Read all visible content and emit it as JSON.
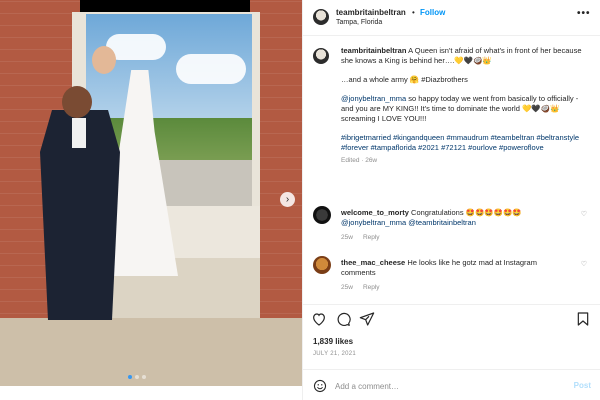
{
  "header": {
    "username": "teambritainbeltran",
    "separator": "•",
    "follow_label": "Follow",
    "location": "Tampa, Florida",
    "more_label": "•••"
  },
  "carousel": {
    "next_label": "›",
    "slides": 3,
    "active_slide": 1
  },
  "caption": {
    "username": "teambritainbeltran",
    "line1": "A Queen isn't afraid of what's in front of her because she knows a King is behind her….💛🖤🥥👑",
    "line2": "…and a whole army 🤗 #Diazbrothers",
    "mention": "@jonybeltran_mma",
    "line3": "so happy today we went from basically to officially - and you are MY KING!! It's time to dominate the world 💛🖤🥥👑 screaming I LOVE YOU!!!",
    "hashtags": "#ibrigetmarried #kingandqueen #mmaudrum #teambeltran #beltranstyle #forever #tampaflorida #2021 #72121 #ourlove #poweroflove",
    "time": "Edited · 26w"
  },
  "comments": [
    {
      "username": "welcome_to_morty",
      "text": "Congratulations 🤩🤩🤩🤩🤩🤩",
      "mention": "@jonybeltran_mma @teambritainbeltran",
      "time": "25w",
      "reply_label": "Reply"
    },
    {
      "username": "thee_mac_cheese",
      "text": "He looks like he gotz mad at Instagram comments",
      "time": "25w",
      "reply_label": "Reply"
    }
  ],
  "actions": {
    "likes": "1,839 likes",
    "date": "JULY 21, 2021"
  },
  "add_comment": {
    "placeholder": "Add a comment…",
    "post_label": "Post"
  },
  "colors": {
    "link_blue": "#0095f6",
    "mention_blue": "#00376b",
    "muted_gray": "#8e8e8e",
    "post_disabled": "#b2dffc"
  }
}
